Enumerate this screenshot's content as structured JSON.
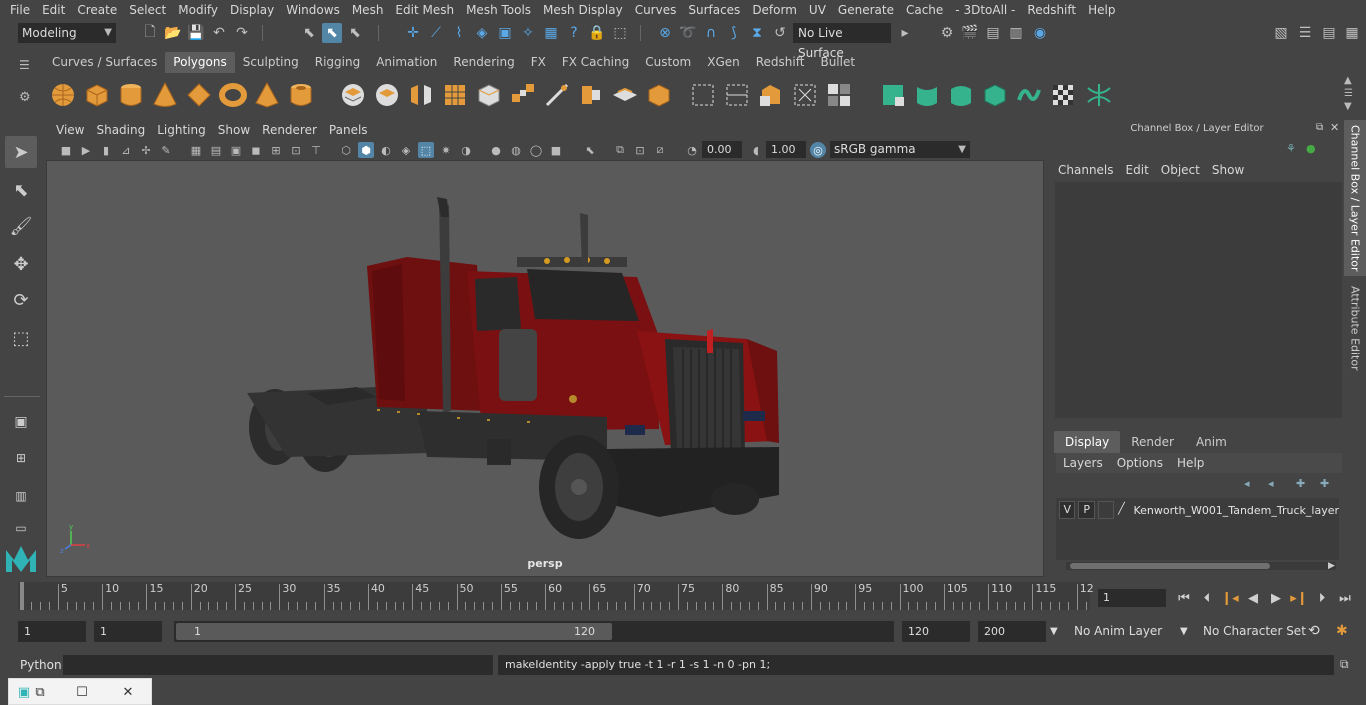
{
  "menubar": {
    "items": [
      "File",
      "Edit",
      "Create",
      "Select",
      "Modify",
      "Display",
      "Windows",
      "Mesh",
      "Edit Mesh",
      "Mesh Tools",
      "Mesh Display",
      "Curves",
      "Surfaces",
      "Deform",
      "UV",
      "Generate",
      "Cache",
      "- 3DtoAll -",
      "Redshift",
      "Help"
    ]
  },
  "status": {
    "mode": "Modeling",
    "live_surface": "No Live Surface"
  },
  "shelf": {
    "tabs": [
      "Curves / Surfaces",
      "Polygons",
      "Sculpting",
      "Rigging",
      "Animation",
      "Rendering",
      "FX",
      "FX Caching",
      "Custom",
      "XGen",
      "Redshift",
      "Bullet"
    ],
    "active_tab": "Polygons"
  },
  "viewport": {
    "menu": [
      "View",
      "Shading",
      "Lighting",
      "Show",
      "Renderer",
      "Panels"
    ],
    "exposure": "0.00",
    "gamma_value": "1.00",
    "color_space": "sRGB gamma",
    "camera_label": "persp"
  },
  "channel_box": {
    "title": "Channel Box / Layer Editor",
    "menu": [
      "Channels",
      "Edit",
      "Object",
      "Show"
    ],
    "side_tabs": [
      "Channel Box / Layer Editor",
      "Attribute Editor"
    ]
  },
  "layer_editor": {
    "tabs": [
      "Display",
      "Render",
      "Anim"
    ],
    "active_tab": "Display",
    "menu": [
      "Layers",
      "Options",
      "Help"
    ],
    "layers": [
      {
        "v": "V",
        "p": "P",
        "name": "Kenworth_W001_Tandem_Truck_layer"
      }
    ]
  },
  "timeline": {
    "ticks": [
      "5",
      "10",
      "15",
      "20",
      "25",
      "30",
      "35",
      "40",
      "45",
      "50",
      "55",
      "60",
      "65",
      "70",
      "75",
      "80",
      "85",
      "90",
      "95",
      "100",
      "105",
      "110",
      "115",
      "12"
    ],
    "start_label": "1",
    "current_frame": "1"
  },
  "range": {
    "start": "1",
    "playback_start": "1",
    "slider_start": "1",
    "slider_end": "120",
    "playback_end": "120",
    "end": "200",
    "anim_layer": "No Anim Layer",
    "character_set": "No Character Set"
  },
  "command": {
    "language": "Python",
    "result": "makeIdentity -apply true -t 1 -r 1 -s 1 -n 0 -pn 1;"
  },
  "colors": {
    "background": "#444444",
    "viewport": "#5a5a5a",
    "accent": "#5285a6",
    "truck_body": "#7a1010"
  }
}
